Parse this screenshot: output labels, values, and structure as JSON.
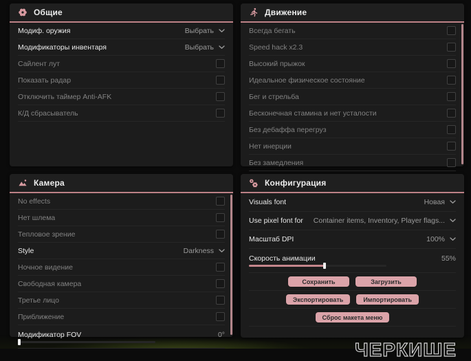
{
  "accent": "#d79aa0",
  "background_text": "ЧЕРКИШЕ",
  "panels": [
    {
      "id": "general",
      "title": "Общие",
      "icon": "gear-icon",
      "scrollbar": false,
      "rows": [
        {
          "type": "dropdown",
          "name": "weapon-mod-dropdown",
          "label": "Модиф. оружия",
          "value": "Выбрать"
        },
        {
          "type": "dropdown",
          "name": "inventory-mods-dropdown",
          "label": "Модификаторы инвентаря",
          "value": "Выбрать"
        },
        {
          "type": "checkbox",
          "name": "silent-loot",
          "label": "Сайлент лут",
          "checked": false
        },
        {
          "type": "checkbox",
          "name": "show-radar",
          "label": "Показать радар",
          "checked": false
        },
        {
          "type": "checkbox",
          "name": "disable-anti-afk-timer",
          "label": "Отключить таймер Anti-AFK",
          "checked": false
        },
        {
          "type": "checkbox",
          "name": "cd-resetter",
          "label": "К/Д сбрасыватель",
          "checked": false
        }
      ]
    },
    {
      "id": "movement",
      "title": "Движение",
      "icon": "runner-icon",
      "scrollbar": true,
      "rows": [
        {
          "type": "checkbox",
          "name": "always-run",
          "label": "Всегда бегать",
          "checked": false
        },
        {
          "type": "checkbox",
          "name": "speed-hack",
          "label": "Speed hack x2.3",
          "checked": false
        },
        {
          "type": "checkbox",
          "name": "high-jump",
          "label": "Высокий прыжок",
          "checked": false
        },
        {
          "type": "checkbox",
          "name": "perfect-physical-condition",
          "label": "Идеальное физическое состояние",
          "checked": false
        },
        {
          "type": "checkbox",
          "name": "run-and-shoot",
          "label": "Бег и стрельба",
          "checked": false
        },
        {
          "type": "checkbox",
          "name": "infinite-stamina",
          "label": "Бесконечная стамина и нет усталости",
          "checked": false
        },
        {
          "type": "checkbox",
          "name": "no-overload-debuff",
          "label": "Без дебаффа перегруз",
          "checked": false
        },
        {
          "type": "checkbox",
          "name": "no-inertia",
          "label": "Нет инерции",
          "checked": false
        },
        {
          "type": "checkbox",
          "name": "no-slowdown",
          "label": "Без замедления",
          "checked": false
        }
      ]
    },
    {
      "id": "camera",
      "title": "Камера",
      "icon": "image-icon",
      "scrollbar": true,
      "rows": [
        {
          "type": "checkbox",
          "name": "no-effects",
          "label": "No effects",
          "checked": false
        },
        {
          "type": "checkbox",
          "name": "no-helmet",
          "label": "Нет шлема",
          "checked": false
        },
        {
          "type": "checkbox",
          "name": "thermal-vision",
          "label": "Тепловое зрение",
          "checked": false
        },
        {
          "type": "dropdown",
          "name": "style-dropdown",
          "label": "Style",
          "value": "Darkness"
        },
        {
          "type": "checkbox",
          "name": "night-vision",
          "label": "Ночное видение",
          "checked": false
        },
        {
          "type": "checkbox",
          "name": "free-camera",
          "label": "Свободная камера",
          "checked": false
        },
        {
          "type": "checkbox",
          "name": "third-person",
          "label": "Третье лицо",
          "checked": false
        },
        {
          "type": "checkbox",
          "name": "zoom-toggle",
          "label": "Приближение",
          "checked": false
        },
        {
          "type": "slider",
          "name": "fov-modifier-slider",
          "label": "Модификатор FOV",
          "value": "0°",
          "percent": 0
        }
      ]
    },
    {
      "id": "config",
      "title": "Конфигурация",
      "icon": "gears-icon",
      "scrollbar": false,
      "rows": [
        {
          "type": "dropdown",
          "name": "visuals-font-dropdown",
          "label": "Visuals font",
          "value": "Новая"
        },
        {
          "type": "dropdown",
          "name": "pixel-font-dropdown",
          "label": "Use pixel font for",
          "value": "Container items, Inventory, Player flags..."
        },
        {
          "type": "dropdown",
          "name": "dpi-scale-dropdown",
          "label": "Масштаб DPI",
          "value": "100%"
        },
        {
          "type": "slider",
          "name": "animation-speed-slider",
          "label": "Скорость анимации",
          "value": "55%",
          "percent": 55
        },
        {
          "type": "buttons",
          "name": "save-load-row",
          "buttons": [
            {
              "name": "save-button",
              "label": "Сохранить"
            },
            {
              "name": "load-button",
              "label": "Загрузить"
            }
          ]
        },
        {
          "type": "buttons",
          "name": "export-import-row",
          "buttons": [
            {
              "name": "export-button",
              "label": "Экспортировать"
            },
            {
              "name": "import-button",
              "label": "Импортировать"
            }
          ]
        },
        {
          "type": "buttons",
          "name": "reset-row",
          "buttons": [
            {
              "name": "reset-menu-layout-button",
              "label": "Сброс макета меню"
            }
          ]
        }
      ]
    }
  ]
}
